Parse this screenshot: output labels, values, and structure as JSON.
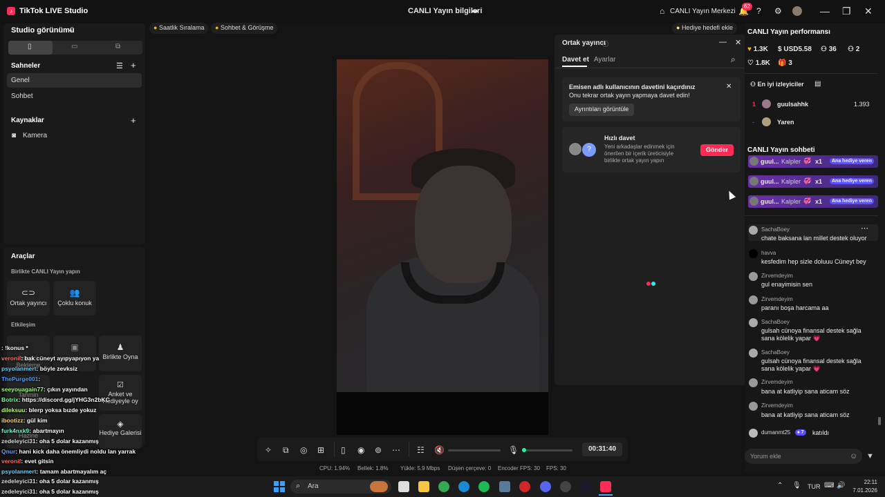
{
  "app": {
    "title": "TikTok LIVE Studio",
    "center_title": "CANLI Yayın bilgileri",
    "live_center": "CANLI Yayın Merkezi",
    "notif_count": "62"
  },
  "left": {
    "studio_view": "Studio görünümü",
    "scenes_title": "Sahneler",
    "scenes": [
      "Genel",
      "Sohbet"
    ],
    "sources_title": "Kaynaklar",
    "sources": [
      "Kamera"
    ],
    "tools_title": "Araçlar",
    "together_title": "Birlikte CANLI Yayın yapın",
    "tools": [
      "Ortak yayıncı",
      "Çoklu konuk"
    ],
    "interaction_title": "Etkileşim",
    "interaction_tools": [
      "İzleyici Bekleme",
      "Tahmin",
      "Hazine",
      "Birlikte Oyna",
      "Anket ve Hediyeyle oy",
      "Hediye Galerisi"
    ]
  },
  "chips": [
    "Saatlik Sıralama",
    "Sohbet & Görüşme",
    "Hediye hedefi ekle"
  ],
  "popup": {
    "title": "Ortak yayıncı",
    "tabs": [
      "Davet et",
      "Ayarlar"
    ],
    "missed_title": "Emisen adlı kullanıcının davetini kaçırdınız",
    "missed_sub": "Onu tekrar ortak yayın yapmaya davet edin!",
    "details_btn": "Ayrıntıları görüntüle",
    "quick_title": "Hızlı davet",
    "quick_desc": "Yeni arkadaşlar edinmek için önerilen bir içerik üreticisiyle birlikte ortak yayın yapın",
    "send_btn": "Gönder"
  },
  "perf": {
    "title": "CANLI Yayın performansı",
    "likes": "1.3K",
    "usd": "USD5.58",
    "viewers": "36",
    "shares": "2",
    "hearts": "1.8K",
    "gifts": "3"
  },
  "top_viewers": {
    "title": "En iyi izleyiciler",
    "rows": [
      {
        "rank": "1",
        "name": "guulsahhk",
        "value": "1.393"
      },
      {
        "rank": "-",
        "name": "Yaren",
        "value": ""
      }
    ]
  },
  "chat": {
    "title": "CANLI Yayın sohbeti",
    "gifts": [
      {
        "user": "guul...",
        "gift": "Kalpler",
        "count": "x1",
        "tag": "Ana hediye veren"
      },
      {
        "user": "guul...",
        "gift": "Kalpler",
        "count": "x1",
        "tag": "Ana hediye veren"
      },
      {
        "user": "guul...",
        "gift": "Kalpler",
        "count": "x1",
        "tag": "Ana hediye veren"
      }
    ],
    "messages": [
      {
        "user": "SachaBoey",
        "text": "chate baksana lan millet destek oluyor"
      },
      {
        "user": "havva",
        "text": "kesfedim hep sizle doluuu Cüneyt bey"
      },
      {
        "user": "Zirvemdeyim",
        "text": "gul enayimisin sen"
      },
      {
        "user": "Zirvemdeyim",
        "text": "paranı boşa harcama aa"
      },
      {
        "user": "SachaBoey",
        "text": "gulsah cünoya finansal destek sağla sana kölelik yapar 💗"
      },
      {
        "user": "SachaBoey",
        "text": "gulsah cünoya finansal destek sağla sana kölelik yapar 💗"
      },
      {
        "user": "Zirvemdeyim",
        "text": "bana at katliyip sana aticam söz"
      },
      {
        "user": "Zirvemdeyim",
        "text": "bana at katliyip sana aticam söz"
      }
    ],
    "joined": {
      "user": "dumanmt25",
      "level": "7",
      "text": "katıldı"
    },
    "input_placeholder": "Yorum ekle"
  },
  "controls": {
    "timer": "00:31:40"
  },
  "stats": {
    "cpu": "CPU: 1.94%",
    "mem": "Bellek: 1.8%",
    "upload": "Yükle: 5.9 Mbps",
    "dropped": "Düşen çerçeve: 0",
    "enc": "Encoder FPS: 30",
    "fps": "FPS: 30"
  },
  "overlay_chat": [
    {
      "name": "",
      "text": ": !konus *"
    },
    {
      "name": "veronif",
      "text": ": bak cüneyt ayıpyapıyon ya"
    },
    {
      "name": "psyolanmert",
      "text": ": böyle zevksiz"
    },
    {
      "name": "ThePurge001",
      "text": ":"
    },
    {
      "name": "seeyouagain77",
      "text": ": çıkın yayından"
    },
    {
      "name": "Botrix",
      "text": ": https://discord.gg/jYHG3n2bKC"
    },
    {
      "name": "dileksuu",
      "text": ": blerp yoksa bızde yokuz"
    },
    {
      "name": "ibootizz",
      "text": ": gül kim"
    },
    {
      "name": "furk4nxk9",
      "text": ": abartmayın"
    },
    {
      "name": "zedeleyici31",
      "text": ": oha 5 dolar kazanmış"
    },
    {
      "name": "Qnur",
      "text": ": hani kick daha önemliydi noldu lan yarrak"
    },
    {
      "name": "veronif",
      "text": ": evet gitsin"
    },
    {
      "name": "psyolanmert",
      "text": ": tamam abartmayalım aç"
    },
    {
      "name": "zedeleyici31",
      "text": ": oha 5 dolar kazanmış"
    },
    {
      "name": "zedeleyici31",
      "text": ": oha 5 dolar kazanmış"
    }
  ],
  "taskbar": {
    "search": "Ara",
    "lang": "TUR",
    "time": "22:11",
    "date": "7.01.2026"
  }
}
